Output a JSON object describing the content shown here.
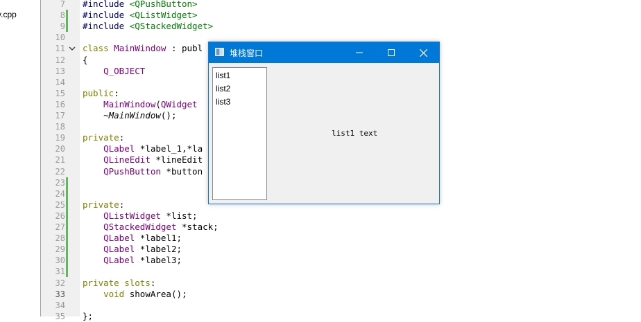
{
  "project": {
    "file_label": "v.cpp"
  },
  "editor": {
    "lines": [
      {
        "n": "7",
        "code": "#include <QPushButton>"
      },
      {
        "n": "8",
        "code": "#include <QListWidget>"
      },
      {
        "n": "9",
        "code": "#include <QStackedWidget>"
      },
      {
        "n": "10",
        "code": ""
      },
      {
        "n": "11",
        "code": "class MainWindow : publ"
      },
      {
        "n": "12",
        "code": "{"
      },
      {
        "n": "13",
        "code": "    Q_OBJECT"
      },
      {
        "n": "14",
        "code": ""
      },
      {
        "n": "15",
        "code": "public:"
      },
      {
        "n": "16",
        "code": "    MainWindow(QWidget"
      },
      {
        "n": "17",
        "code": "    ~MainWindow();"
      },
      {
        "n": "18",
        "code": ""
      },
      {
        "n": "19",
        "code": "private:"
      },
      {
        "n": "20",
        "code": "    QLabel *label_1,*la"
      },
      {
        "n": "21",
        "code": "    QLineEdit *lineEdit"
      },
      {
        "n": "22",
        "code": "    QPushButton *button"
      },
      {
        "n": "23",
        "code": ""
      },
      {
        "n": "24",
        "code": ""
      },
      {
        "n": "25",
        "code": "private:"
      },
      {
        "n": "26",
        "code": "    QListWidget *list;"
      },
      {
        "n": "27",
        "code": "    QStackedWidget *stack;"
      },
      {
        "n": "28",
        "code": "    QLabel *label1;"
      },
      {
        "n": "29",
        "code": "    QLabel *label2;"
      },
      {
        "n": "30",
        "code": "    QLabel *label3;"
      },
      {
        "n": "31",
        "code": ""
      },
      {
        "n": "32",
        "code": "private slots:"
      },
      {
        "n": "33",
        "code": "    void showArea();"
      },
      {
        "n": "34",
        "code": ""
      },
      {
        "n": "35",
        "code": "};"
      }
    ]
  },
  "window": {
    "title": "堆栈窗口",
    "list_items": [
      "list1",
      "list2",
      "list3"
    ],
    "stack_text": "list1 text",
    "title_bar_color": "#0078d7",
    "icons": {
      "app": "qt-window-icon",
      "minimize": "minimize-icon",
      "maximize": "maximize-icon",
      "close": "close-icon"
    }
  },
  "colors": {
    "keyword": "#808000",
    "type": "#800080",
    "string": "#008000",
    "change_marker": "#5fb85f"
  }
}
